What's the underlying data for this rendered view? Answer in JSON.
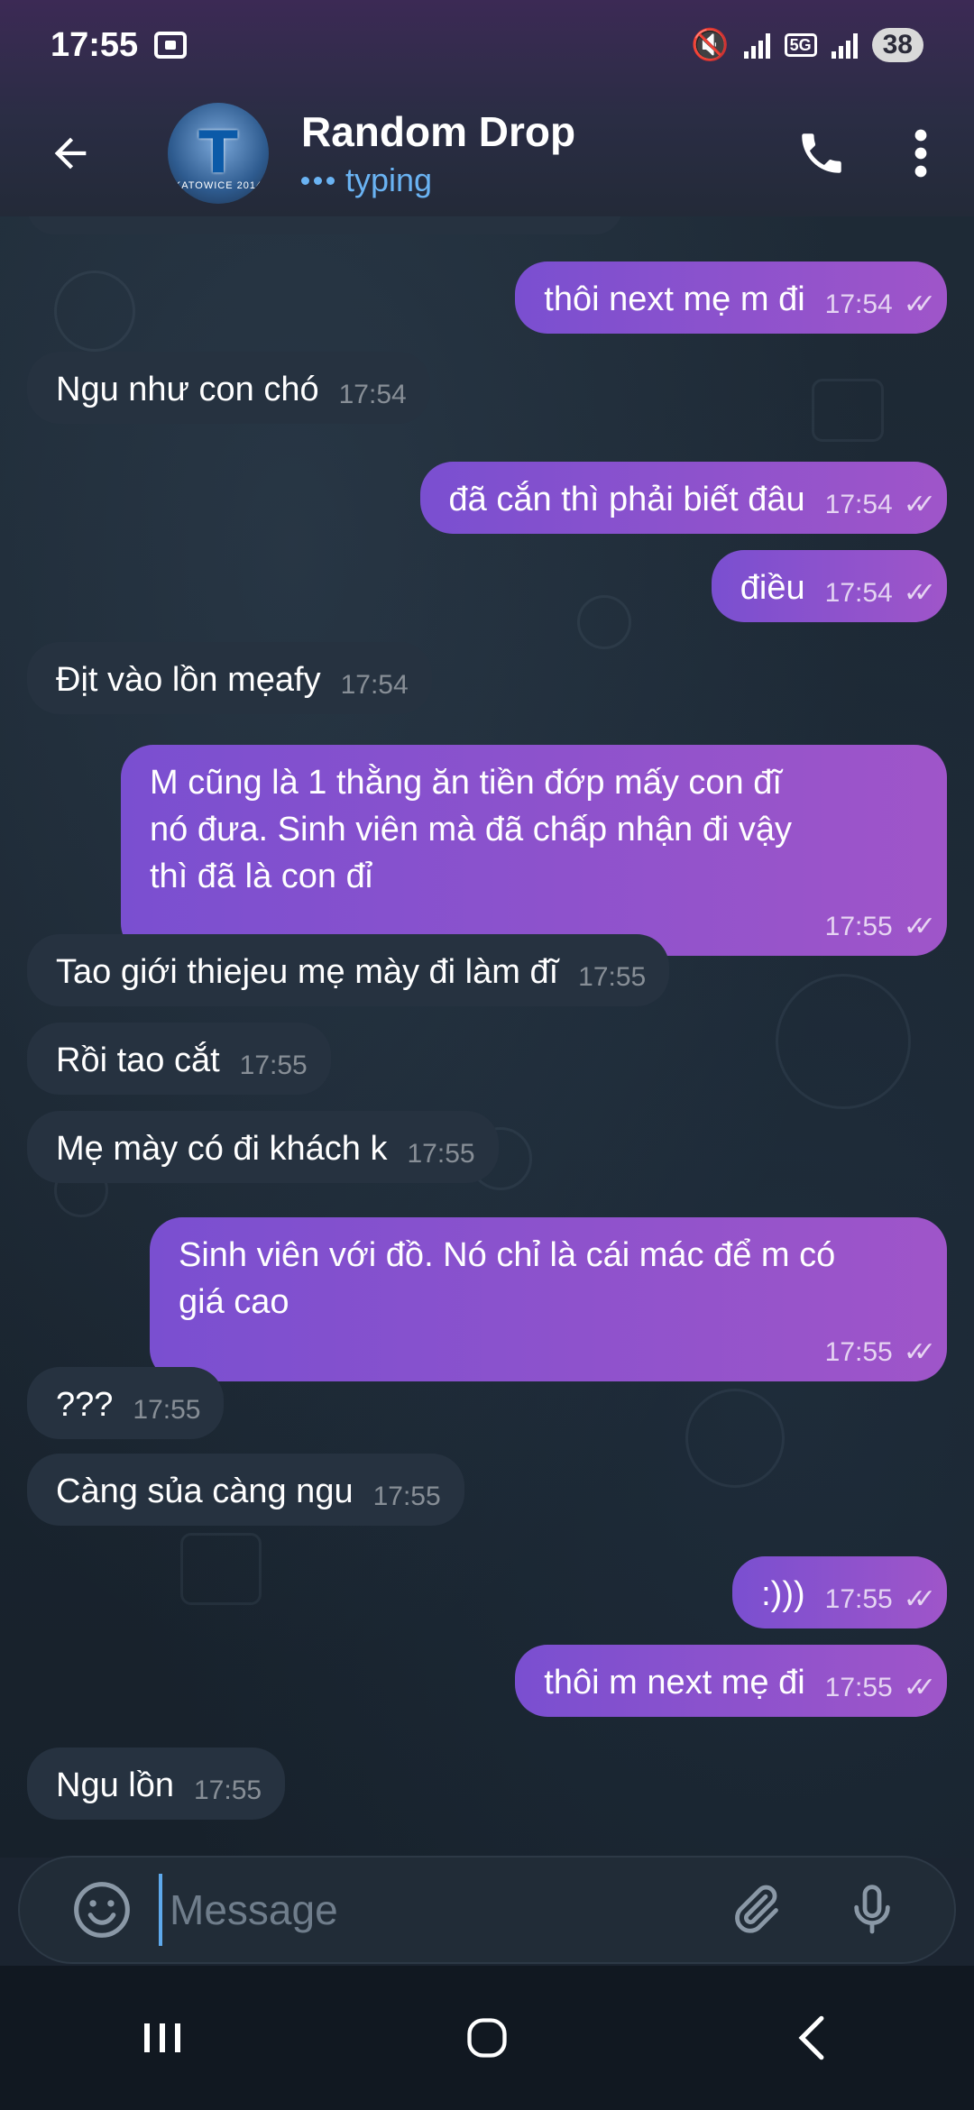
{
  "status_bar": {
    "time": "17:55",
    "battery": "38",
    "network": "5G"
  },
  "header": {
    "title": "Random Drop",
    "subtitle": "typing",
    "avatar_caption": "KATOWICE 2014"
  },
  "messages": [
    {
      "dir": "out",
      "text": "thôi next mẹ m đi",
      "time": "17:54"
    },
    {
      "dir": "in",
      "text": "Ngu như con chó",
      "time": "17:54"
    },
    {
      "dir": "out",
      "text": "đã cắn thì phải biết đâu",
      "time": "17:54"
    },
    {
      "dir": "out",
      "text": "điều",
      "time": "17:54"
    },
    {
      "dir": "in",
      "text": "Địt vào lồn mẹafy",
      "time": "17:54"
    },
    {
      "dir": "out",
      "text": "M cũng là 1 thằng ăn tiền đớp mấy con đĩ\nnó đưa. Sinh viên mà đã chấp nhận đi vậy\nthì đã là con đỉ",
      "time": "17:55"
    },
    {
      "dir": "in",
      "text": "Tao giới thiejeu mẹ mày đi làm đĩ",
      "time": "17:55"
    },
    {
      "dir": "in",
      "text": "Rồi tao cắt",
      "time": "17:55"
    },
    {
      "dir": "in",
      "text": "Mẹ mày có đi khách k",
      "time": "17:55"
    },
    {
      "dir": "out",
      "text": "Sinh viên với đồ. Nó chỉ là cái mác để m có\ngiá cao",
      "time": "17:55"
    },
    {
      "dir": "in",
      "text": "???",
      "time": "17:55"
    },
    {
      "dir": "in",
      "text": "Càng sủa càng ngu",
      "time": "17:55"
    },
    {
      "dir": "out",
      "text": ":)))",
      "time": "17:55"
    },
    {
      "dir": "out",
      "text": "thôi m next mẹ đi",
      "time": "17:55"
    },
    {
      "dir": "in",
      "text": "Ngu lồn",
      "time": "17:55"
    }
  ],
  "composer": {
    "placeholder": "Message"
  },
  "colors": {
    "accent": "#6ab3f3",
    "outgoing": "#8a52cd",
    "incoming": "#263240"
  },
  "icons": [
    "back-arrow-icon",
    "phone-icon",
    "more-vertical-icon",
    "emoji-icon",
    "paperclip-icon",
    "microphone-icon",
    "double-check-icon"
  ]
}
